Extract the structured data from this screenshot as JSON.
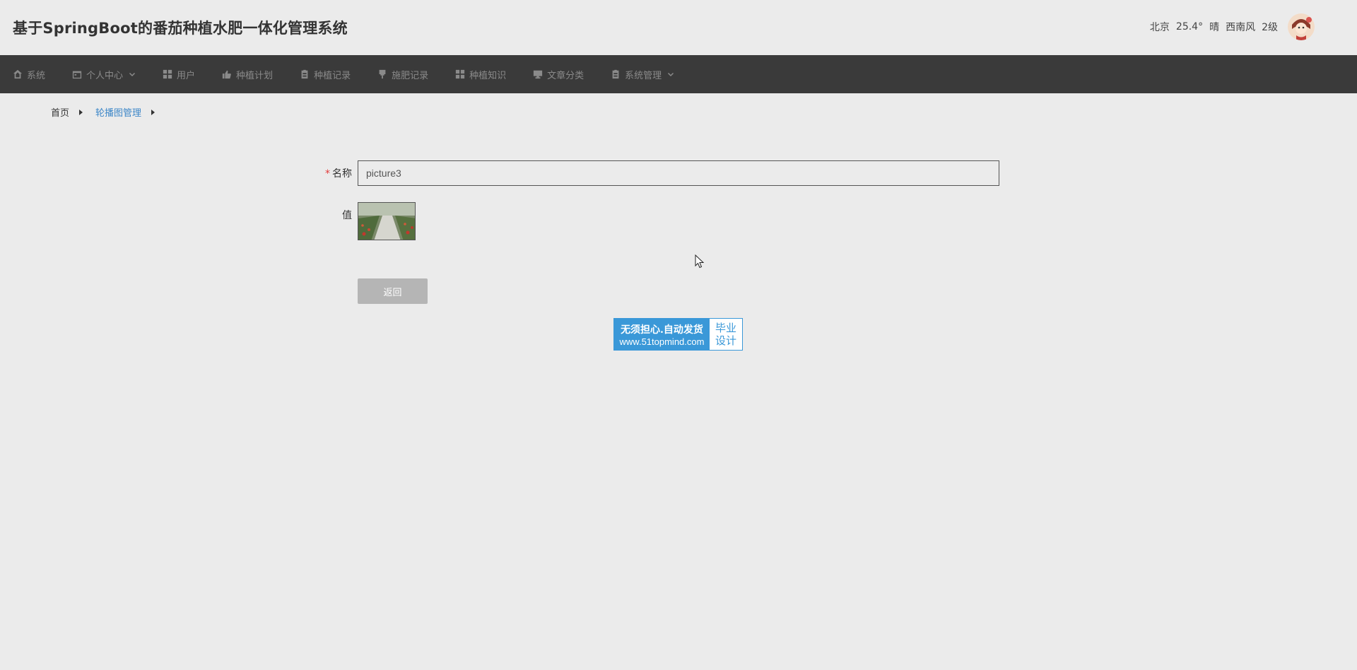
{
  "header": {
    "title": "基于SpringBoot的番茄种植水肥一体化管理系统",
    "weather": {
      "city": "北京",
      "temperature": "25.4°",
      "condition": "晴",
      "wind": "西南风",
      "level": "2级"
    }
  },
  "nav": {
    "items": [
      {
        "label": "系统",
        "icon": "home-icon"
      },
      {
        "label": "个人中心",
        "icon": "calendar-icon",
        "dropdown": true
      },
      {
        "label": "用户",
        "icon": "grid-icon"
      },
      {
        "label": "种植计划",
        "icon": "thumbs-up-icon"
      },
      {
        "label": "种植记录",
        "icon": "clipboard-icon"
      },
      {
        "label": "施肥记录",
        "icon": "brush-icon"
      },
      {
        "label": "种植知识",
        "icon": "grid-icon"
      },
      {
        "label": "文章分类",
        "icon": "monitor-icon"
      },
      {
        "label": "系统管理",
        "icon": "clipboard-icon",
        "dropdown": true
      }
    ]
  },
  "breadcrumb": {
    "home": "首页",
    "current": "轮播图管理"
  },
  "form": {
    "name_label": "名称",
    "required_mark": "*",
    "name_value": "picture3",
    "value_label": "值",
    "back_label": "返回"
  },
  "watermark": {
    "line1": "无须担心.自动发货",
    "line2": "www.51topmind.com",
    "side1": "毕业",
    "side2": "设计"
  },
  "colors": {
    "navbar": "#3a3a3a",
    "link": "#3d87c8",
    "background": "#ebebeb",
    "watermark": "#3a98d8"
  }
}
